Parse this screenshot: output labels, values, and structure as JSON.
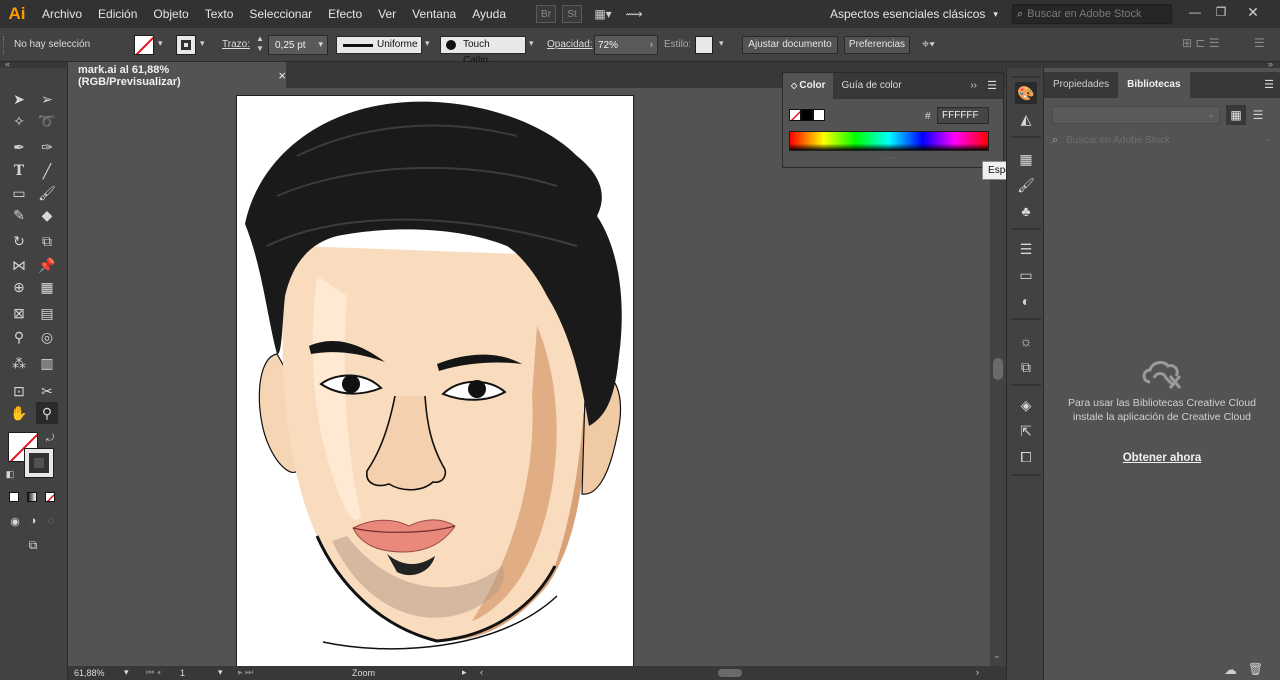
{
  "app": {
    "logo": "Ai",
    "accent": "#ff9a00"
  },
  "menu": [
    "Archivo",
    "Edición",
    "Objeto",
    "Texto",
    "Seleccionar",
    "Efecto",
    "Ver",
    "Ventana",
    "Ayuda"
  ],
  "bridge_buttons": [
    "Br",
    "St"
  ],
  "workspace": {
    "label": "Aspectos esenciales clásicos"
  },
  "search": {
    "placeholder": "Buscar en Adobe Stock"
  },
  "controlbar": {
    "selection": "No hay selección",
    "stroke_label": "Trazo:",
    "stroke_value": "0,25 pt",
    "profile": "Uniforme",
    "brush": "Touch Callig...",
    "opacity_label": "Opacidad:",
    "opacity_value": "72%",
    "style_label": "Estilo:",
    "btn_adjust": "Ajustar documento",
    "btn_prefs": "Preferencias"
  },
  "document": {
    "tab_title": "mark.ai al 61,88% (RGB/Previsualizar)",
    "close_glyph": "×"
  },
  "statusbar": {
    "zoom": "61,88%",
    "page": "1",
    "tool_name": "Zoom"
  },
  "color_panel": {
    "tabs": [
      "Color",
      "Guía de color"
    ],
    "hex_prefix": "#",
    "hex_value": "FFFFFF",
    "tooltip": "Espectro RGB"
  },
  "libraries_panel": {
    "tabs": [
      "Propiedades",
      "Bibliotecas"
    ],
    "search_placeholder": "Buscar en Adobe Stock",
    "message": "Para usar las Bibliotecas Creative Cloud instale la aplicación de Creative Cloud",
    "link": "Obtener ahora"
  }
}
